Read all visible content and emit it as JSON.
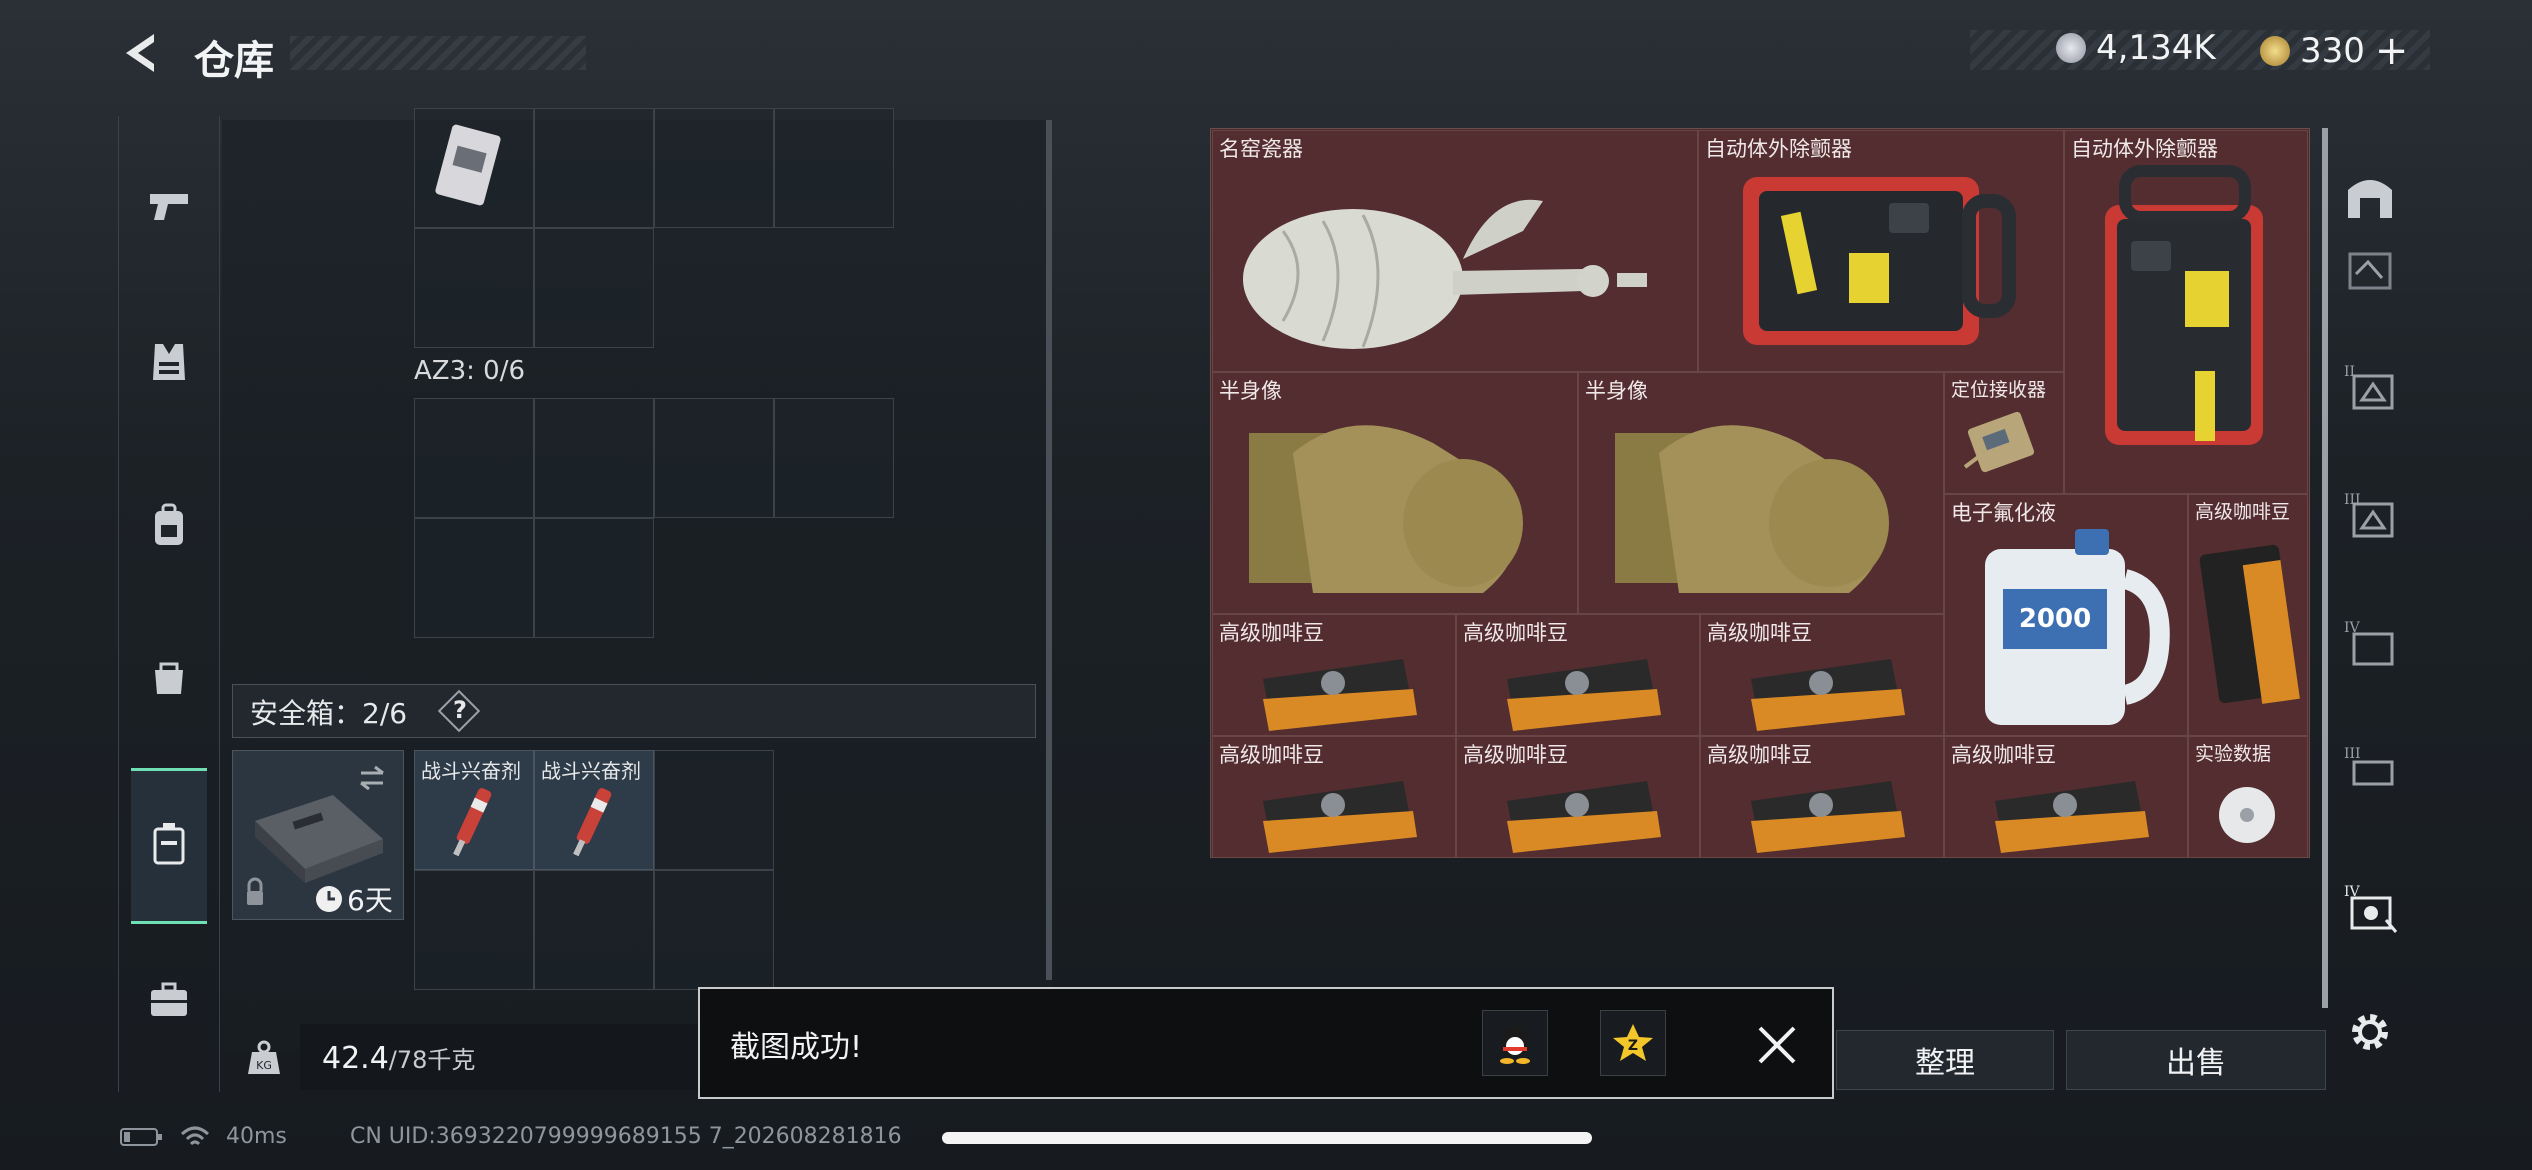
{
  "header": {
    "title": "仓库",
    "currency1": "4,134K",
    "currency2": "330",
    "currency2_plus": "+"
  },
  "left": {
    "az3_label": "AZ3: 0/6",
    "safebox_label": "安全箱：2/6",
    "safebox_help": "?",
    "safebox_days": "6天",
    "items": [
      {
        "label": "战斗兴奋剂"
      },
      {
        "label": "战斗兴奋剂"
      }
    ],
    "weight_current": "42.4",
    "weight_max": "/78千克",
    "kg_icon_text": "KG"
  },
  "storage": {
    "items": [
      {
        "label": "名窑瓷器",
        "icon": "porcelain-vase"
      },
      {
        "label": "自动体外除颤器",
        "icon": "aed"
      },
      {
        "label": "自动体外除颤器",
        "icon": "aed"
      },
      {
        "label": "半身像",
        "icon": "bust-statue"
      },
      {
        "label": "半身像",
        "icon": "bust-statue"
      },
      {
        "label": "定位接收器",
        "icon": "receiver"
      },
      {
        "label": "电子氟化液",
        "icon": "fluid-jug"
      },
      {
        "label": "高级咖啡豆",
        "icon": "coffee-beans"
      },
      {
        "label": "高级咖啡豆",
        "icon": "coffee-beans"
      },
      {
        "label": "高级咖啡豆",
        "icon": "coffee-beans"
      },
      {
        "label": "高级咖啡豆",
        "icon": "coffee-beans"
      },
      {
        "label": "高级咖啡豆",
        "icon": "coffee-beans"
      },
      {
        "label": "高级咖啡豆",
        "icon": "coffee-beans"
      },
      {
        "label": "高级咖啡豆",
        "icon": "coffee-beans"
      },
      {
        "label": "高级咖啡豆",
        "icon": "coffee-beans"
      },
      {
        "label": "实验数据",
        "icon": "data-disc"
      }
    ],
    "fluid_jug_text": "2000"
  },
  "buttons": {
    "sort": "整理",
    "sell": "出售"
  },
  "toast": {
    "message": "截图成功!"
  },
  "status": {
    "ping": "40ms",
    "uid": "CN UID:3693220799999689155 7_202608281816"
  },
  "colors": {
    "accent": "#6ee0b4",
    "storage_bg": "#4a2a2c"
  }
}
